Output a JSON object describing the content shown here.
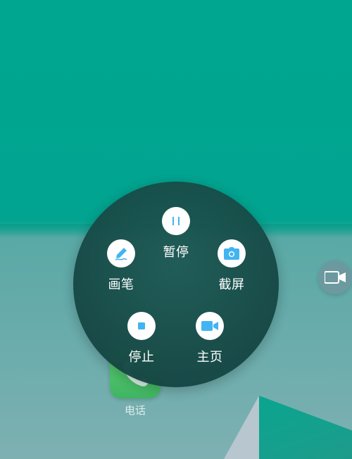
{
  "menu": {
    "pause_label": "暂停",
    "pen_label": "画笔",
    "screenshot_label": "截屏",
    "stop_label": "停止",
    "home_label": "主页"
  },
  "desktop": {
    "apps": [
      {
        "label": "电话",
        "icon": "phone-icon"
      }
    ]
  },
  "icons": {
    "pause": "pause-icon",
    "pen": "pen-icon",
    "screenshot": "camera-icon",
    "stop": "stop-icon",
    "home": "video-camera-icon",
    "floating": "video-camera-icon"
  },
  "colors": {
    "accent": "#42b4f2",
    "menu_background": "#174a47",
    "wallpaper_top": "#00a690"
  }
}
